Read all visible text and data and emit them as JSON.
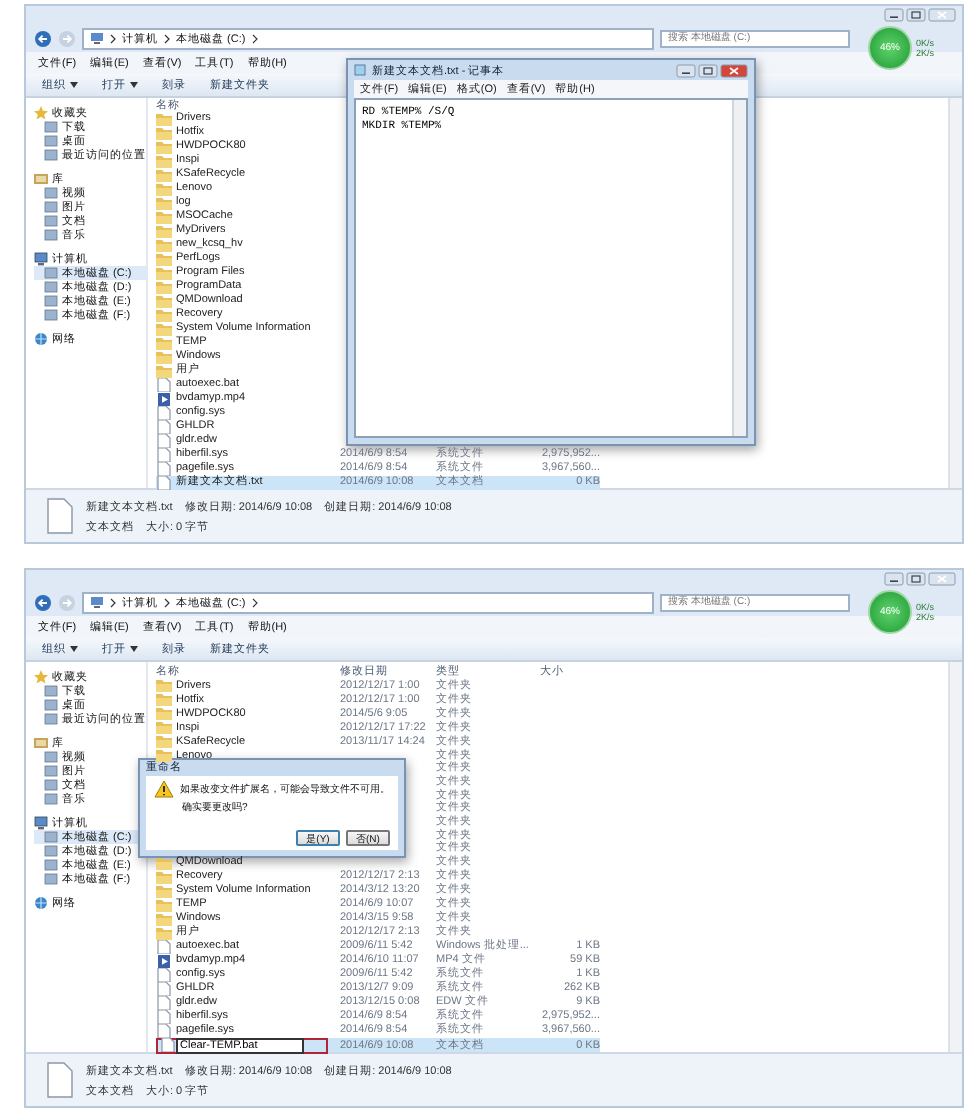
{
  "panels": [
    {
      "address": {
        "path": [
          "计算机",
          "本地磁盘 (C:)"
        ],
        "search_placeholder": "搜索 本地磁盘 (C:)"
      },
      "speed_widget": {
        "value": "46%",
        "up": "0K/s",
        "down": "2K/s"
      },
      "menu": [
        "文件(F)",
        "编辑(E)",
        "查看(V)",
        "工具(T)",
        "帮助(H)"
      ],
      "toolbar": [
        {
          "label": "组织",
          "dropdown": true
        },
        {
          "label": "打开",
          "dropdown": true
        },
        {
          "label": "刻录",
          "dropdown": false
        },
        {
          "label": "新建文件夹",
          "dropdown": false
        }
      ],
      "sidebar": [
        {
          "label": "收藏夹",
          "kind": "favorites",
          "selected": false,
          "children": [
            {
              "label": "下载",
              "selected": false
            },
            {
              "label": "桌面",
              "selected": false
            },
            {
              "label": "最近访问的位置",
              "selected": false
            }
          ]
        },
        {
          "label": "库",
          "kind": "library",
          "selected": false,
          "children": [
            {
              "label": "视频",
              "selected": false
            },
            {
              "label": "图片",
              "selected": false
            },
            {
              "label": "文档",
              "selected": false
            },
            {
              "label": "音乐",
              "selected": false
            }
          ]
        },
        {
          "label": "计算机",
          "kind": "computer",
          "selected": false,
          "children": [
            {
              "label": "本地磁盘 (C:)",
              "selected": true
            },
            {
              "label": "本地磁盘 (D:)",
              "selected": false
            },
            {
              "label": "本地磁盘 (E:)",
              "selected": false
            },
            {
              "label": "本地磁盘 (F:)",
              "selected": false
            }
          ]
        },
        {
          "label": "网络",
          "kind": "network",
          "selected": false
        }
      ],
      "columns": [
        "名称"
      ],
      "rows": [
        {
          "name": "Drivers",
          "kind": "folder",
          "selected": false
        },
        {
          "name": "Hotfix",
          "kind": "folder",
          "selected": false
        },
        {
          "name": "HWDPOCK80",
          "kind": "folder",
          "selected": false
        },
        {
          "name": "Inspi",
          "kind": "folder",
          "selected": false
        },
        {
          "name": "KSafeRecycle",
          "kind": "folder",
          "selected": false
        },
        {
          "name": "Lenovo",
          "kind": "folder",
          "selected": false
        },
        {
          "name": "log",
          "kind": "folder",
          "selected": false
        },
        {
          "name": "MSOCache",
          "kind": "folder",
          "selected": false
        },
        {
          "name": "MyDrivers",
          "kind": "folder",
          "selected": false
        },
        {
          "name": "new_kcsq_hv",
          "kind": "folder",
          "selected": false
        },
        {
          "name": "PerfLogs",
          "kind": "folder",
          "selected": false
        },
        {
          "name": "Program Files",
          "kind": "folder",
          "selected": false
        },
        {
          "name": "ProgramData",
          "kind": "folder",
          "selected": false
        },
        {
          "name": "QMDownload",
          "kind": "folder",
          "selected": false
        },
        {
          "name": "Recovery",
          "kind": "folder",
          "selected": false
        },
        {
          "name": "System Volume Information",
          "kind": "folder",
          "selected": false
        },
        {
          "name": "TEMP",
          "kind": "folder",
          "selected": false
        },
        {
          "name": "Windows",
          "kind": "folder",
          "selected": false
        },
        {
          "name": "用户",
          "kind": "folder",
          "selected": false
        },
        {
          "name": "autoexec.bat",
          "kind": "file",
          "selected": false
        },
        {
          "name": "bvdamyp.mp4",
          "kind": "media",
          "selected": false
        },
        {
          "name": "config.sys",
          "kind": "file",
          "selected": false
        },
        {
          "name": "GHLDR",
          "kind": "file",
          "selected": false
        },
        {
          "name": "gldr.edw",
          "kind": "file",
          "selected": false
        },
        {
          "name": "hiberfil.sys",
          "kind": "file",
          "date": "2014/6/9 8:54",
          "type": "系统文件",
          "size": "2,975,952...",
          "selected": false
        },
        {
          "name": "pagefile.sys",
          "kind": "file",
          "date": "2014/6/9 8:54",
          "type": "系统文件",
          "size": "3,967,560...",
          "selected": false
        },
        {
          "name": "新建文本文档.txt",
          "kind": "file",
          "date": "2014/6/9 10:08",
          "type": "文本文档",
          "size": "0 KB",
          "selected": true
        }
      ],
      "overlay": {
        "kind": "notepad",
        "title": "新建文本文档.txt - 记事本",
        "menu": [
          "文件(F)",
          "编辑(E)",
          "格式(O)",
          "查看(V)",
          "帮助(H)"
        ],
        "lines": [
          "RD %TEMP% /S/Q",
          "MKDIR %TEMP%"
        ]
      },
      "details": {
        "name": "新建文本文档.txt",
        "modified": "修改日期: 2014/6/9 10:08",
        "created": "创建日期: 2014/6/9 10:08",
        "type": "文本文档",
        "size": "大小: 0 字节"
      }
    },
    {
      "address": {
        "path": [
          "计算机",
          "本地磁盘 (C:)"
        ],
        "search_placeholder": "搜索 本地磁盘 (C:)"
      },
      "speed_widget": {
        "value": "46%",
        "up": "0K/s",
        "down": "2K/s"
      },
      "menu": [
        "文件(F)",
        "编辑(E)",
        "查看(V)",
        "工具(T)",
        "帮助(H)"
      ],
      "toolbar": [
        {
          "label": "组织",
          "dropdown": true
        },
        {
          "label": "打开",
          "dropdown": true
        },
        {
          "label": "刻录",
          "dropdown": false
        },
        {
          "label": "新建文件夹",
          "dropdown": false
        }
      ],
      "sidebar": [
        {
          "label": "收藏夹",
          "kind": "favorites",
          "selected": false,
          "children": [
            {
              "label": "下载",
              "selected": false
            },
            {
              "label": "桌面",
              "selected": false
            },
            {
              "label": "最近访问的位置",
              "selected": false
            }
          ]
        },
        {
          "label": "库",
          "kind": "library",
          "selected": false,
          "children": [
            {
              "label": "视频",
              "selected": false
            },
            {
              "label": "图片",
              "selected": false
            },
            {
              "label": "文档",
              "selected": false
            },
            {
              "label": "音乐",
              "selected": false
            }
          ]
        },
        {
          "label": "计算机",
          "kind": "computer",
          "selected": false,
          "children": [
            {
              "label": "本地磁盘 (C:)",
              "selected": true
            },
            {
              "label": "本地磁盘 (D:)",
              "selected": false
            },
            {
              "label": "本地磁盘 (E:)",
              "selected": false
            },
            {
              "label": "本地磁盘 (F:)",
              "selected": false
            }
          ]
        },
        {
          "label": "网络",
          "kind": "network",
          "selected": false
        }
      ],
      "columns": [
        "名称",
        "修改日期",
        "类型",
        "大小"
      ],
      "rows": [
        {
          "name": "Drivers",
          "kind": "folder",
          "date": "2012/12/17 1:00",
          "type": "文件夹",
          "selected": false
        },
        {
          "name": "Hotfix",
          "kind": "folder",
          "date": "2012/12/17 1:00",
          "type": "文件夹",
          "selected": false
        },
        {
          "name": "HWDPOCK80",
          "kind": "folder",
          "date": "2014/5/6 9:05",
          "type": "文件夹",
          "selected": false
        },
        {
          "name": "Inspi",
          "kind": "folder",
          "date": "2012/12/17 17:22",
          "type": "文件夹",
          "selected": false
        },
        {
          "name": "KSafeRecycle",
          "kind": "folder",
          "date": "2013/11/17 14:24",
          "type": "文件夹",
          "selected": false
        },
        {
          "name": "Lenovo",
          "kind": "folder",
          "type": "文件夹",
          "selected": false
        },
        {
          "type": "文件夹",
          "selected": false
        },
        {
          "type": "文件夹",
          "selected": false
        },
        {
          "type": "文件夹",
          "selected": false
        },
        {
          "type": "文件夹",
          "selected": false
        },
        {
          "type": "文件夹",
          "selected": false
        },
        {
          "type": "文件夹",
          "selected": false
        },
        {
          "type": "文件夹",
          "selected": false
        },
        {
          "name": "QMDownload",
          "kind": "folder",
          "type": "文件夹",
          "selected": false
        },
        {
          "name": "Recovery",
          "kind": "folder",
          "date": "2012/12/17 2:13",
          "type": "文件夹",
          "selected": false
        },
        {
          "name": "System Volume Information",
          "kind": "folder",
          "date": "2014/3/12 13:20",
          "type": "文件夹",
          "selected": false
        },
        {
          "name": "TEMP",
          "kind": "folder",
          "date": "2014/6/9 10:07",
          "type": "文件夹",
          "selected": false
        },
        {
          "name": "Windows",
          "kind": "folder",
          "date": "2014/3/15 9:58",
          "type": "文件夹",
          "selected": false
        },
        {
          "name": "用户",
          "kind": "folder",
          "date": "2012/12/17 2:13",
          "type": "文件夹",
          "selected": false
        },
        {
          "name": "autoexec.bat",
          "kind": "file",
          "date": "2009/6/11 5:42",
          "type": "Windows 批处理...",
          "size": "1 KB",
          "selected": false
        },
        {
          "name": "bvdamyp.mp4",
          "kind": "media",
          "date": "2014/6/10 11:07",
          "type": "MP4 文件",
          "size": "59 KB",
          "selected": false
        },
        {
          "name": "config.sys",
          "kind": "file",
          "date": "2009/6/11 5:42",
          "type": "系统文件",
          "size": "1 KB",
          "selected": false
        },
        {
          "name": "GHLDR",
          "kind": "file",
          "date": "2013/12/7 9:09",
          "type": "系统文件",
          "size": "262 KB",
          "selected": false
        },
        {
          "name": "gldr.edw",
          "kind": "file",
          "date": "2013/12/15 0:08",
          "type": "EDW 文件",
          "size": "9 KB",
          "selected": false
        },
        {
          "name": "hiberfil.sys",
          "kind": "file",
          "date": "2014/6/9 8:54",
          "type": "系统文件",
          "size": "2,975,952...",
          "selected": false
        },
        {
          "name": "pagefile.sys",
          "kind": "file",
          "date": "2014/6/9 8:54",
          "type": "系统文件",
          "size": "3,967,560...",
          "selected": false
        },
        {
          "name": "Clear-TEMP.bat",
          "kind": "file",
          "date": "2014/6/9 10:08",
          "type": "文本文档",
          "size": "0 KB",
          "selected": true,
          "editing": true
        }
      ],
      "overlay": {
        "kind": "dialog",
        "title": "重命名",
        "message": "如果改变文件扩展名，可能会导致文件不可用。",
        "question": "确实要更改吗?",
        "buttons": [
          "是(Y)",
          "否(N)"
        ]
      },
      "details": {
        "name": "新建文本文档.txt",
        "modified": "修改日期: 2014/6/9 10:08",
        "created": "创建日期: 2014/6/9 10:08",
        "type": "文本文档",
        "size": "大小: 0 字节"
      }
    }
  ]
}
